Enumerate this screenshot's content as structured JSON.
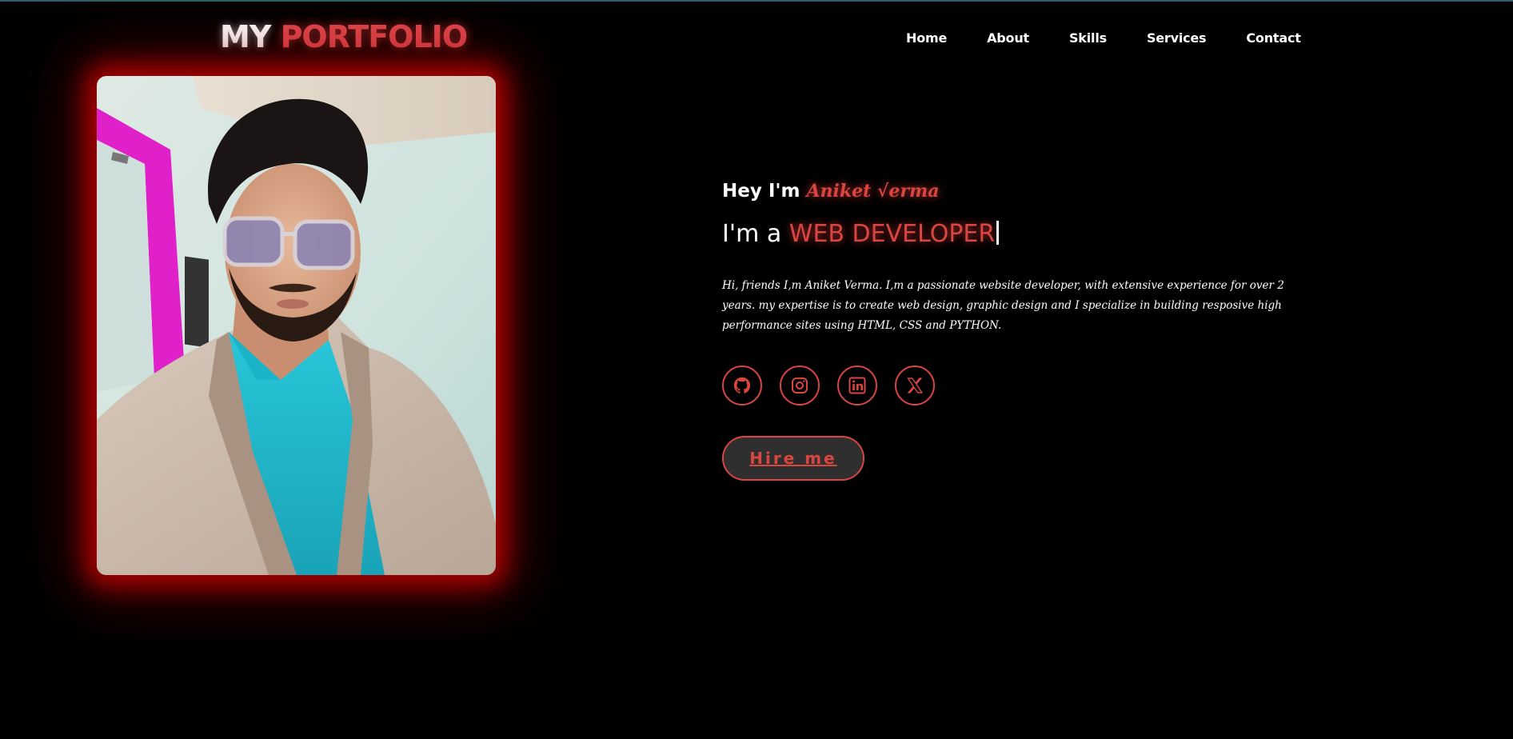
{
  "header": {
    "logo_white": "MY",
    "logo_red": "PORTFOLIO",
    "nav": [
      {
        "label": "Home"
      },
      {
        "label": "About"
      },
      {
        "label": "Skills"
      },
      {
        "label": "Services"
      },
      {
        "label": "Contact"
      }
    ]
  },
  "hero": {
    "greeting": "Hey I'm",
    "name": "Aniket √erma",
    "role_prefix": "I'm a",
    "role": "WEB DEVELOPER",
    "bio": "Hi, friends I,m Aniket Verma. I,m a passionate website developer, with extensive experience for over 2 years. my expertise is to create web design, graphic design and I specialize in building resposive high performance sites using HTML, CSS and PYTHON.",
    "socials": [
      {
        "icon": "github-icon"
      },
      {
        "icon": "instagram-icon"
      },
      {
        "icon": "linkedin-icon"
      },
      {
        "icon": "x-icon"
      }
    ],
    "hire_label": "Hire me"
  },
  "colors": {
    "accent": "#d9463f",
    "background": "#000000",
    "glow": "#be0000"
  }
}
